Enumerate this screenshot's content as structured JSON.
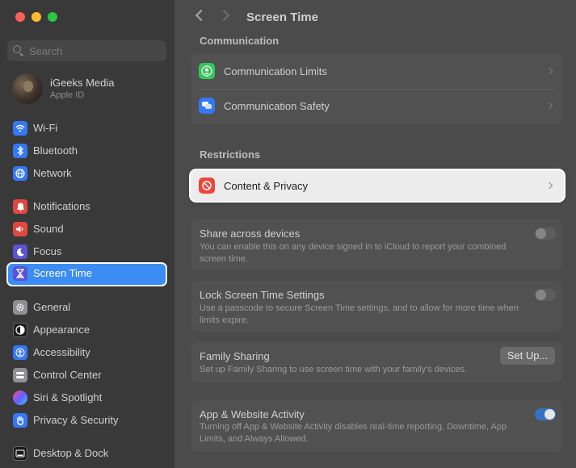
{
  "window": {
    "title": "Screen Time"
  },
  "sidebar": {
    "search_placeholder": "Search",
    "account": {
      "name": "iGeeks Media",
      "subtitle": "Apple ID"
    },
    "items": [
      {
        "label": "Wi-Fi",
        "icon": "wifi-icon",
        "color": "#3478f6"
      },
      {
        "label": "Bluetooth",
        "icon": "bluetooth-icon",
        "color": "#3478f6"
      },
      {
        "label": "Network",
        "icon": "globe-icon",
        "color": "#3478f6"
      },
      {
        "label": "Notifications",
        "icon": "bell-icon",
        "color": "#e2473f"
      },
      {
        "label": "Sound",
        "icon": "speaker-icon",
        "color": "#e2473f"
      },
      {
        "label": "Focus",
        "icon": "moon-icon",
        "color": "#5b52d6"
      },
      {
        "label": "Screen Time",
        "icon": "hourglass-icon",
        "color": "#5b52d6",
        "active": true
      },
      {
        "label": "General",
        "icon": "gear-icon",
        "color": "#8e8e93"
      },
      {
        "label": "Appearance",
        "icon": "appearance-icon",
        "color": "#1c1c1e"
      },
      {
        "label": "Accessibility",
        "icon": "accessibility-icon",
        "color": "#3478f6"
      },
      {
        "label": "Control Center",
        "icon": "control-center-icon",
        "color": "#8e8e93"
      },
      {
        "label": "Siri & Spotlight",
        "icon": "siri-icon",
        "color": "#a53cd6"
      },
      {
        "label": "Privacy & Security",
        "icon": "hand-icon",
        "color": "#3478f6"
      },
      {
        "label": "Desktop & Dock",
        "icon": "dock-icon",
        "color": "#1c1c1e"
      }
    ]
  },
  "main": {
    "sections": {
      "communication": "Communication",
      "restrictions": "Restrictions"
    },
    "communication_rows": [
      {
        "label": "Communication Limits",
        "icon": "person-icon",
        "color": "#34c759"
      },
      {
        "label": "Communication Safety",
        "icon": "chat-bubbles-icon",
        "color": "#3478f6"
      }
    ],
    "content_privacy": {
      "label": "Content & Privacy",
      "icon": "no-entry-icon",
      "color": "#f0453a"
    },
    "share": {
      "title": "Share across devices",
      "desc": "You can enable this on any device signed in to iCloud to report your combined screen time.",
      "enabled": false
    },
    "lock": {
      "title": "Lock Screen Time Settings",
      "desc": "Use a passcode to secure Screen Time settings, and to allow for more time when limits expire.",
      "enabled": false
    },
    "family": {
      "title": "Family Sharing",
      "desc": "Set up Family Sharing to use screen time with your family's devices.",
      "button": "Set Up..."
    },
    "activity": {
      "title": "App & Website Activity",
      "desc": "Turning off App & Website Activity disables real-time reporting, Downtime, App Limits, and Always Allowed.",
      "enabled": true
    }
  }
}
